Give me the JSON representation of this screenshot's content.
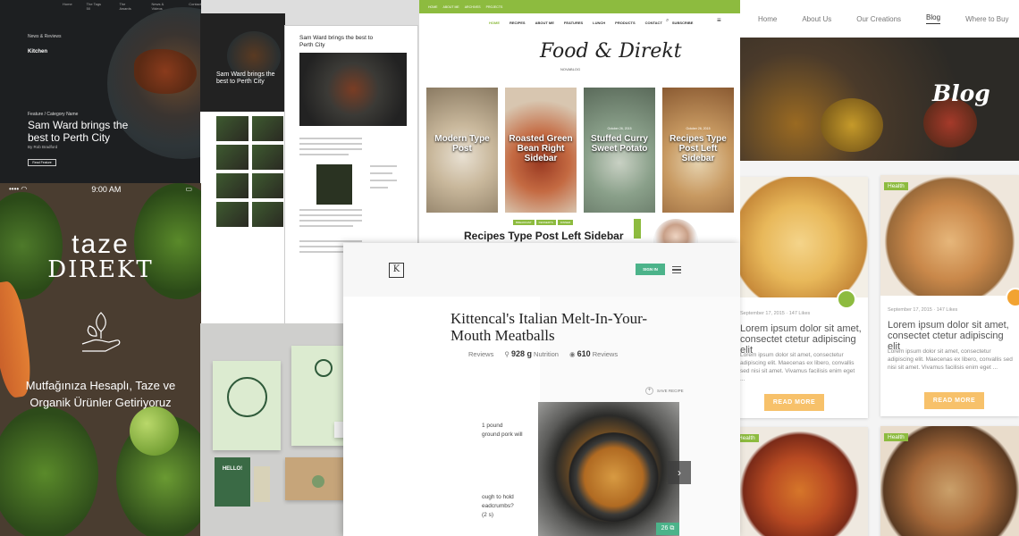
{
  "p1": {
    "nav": [
      "Home",
      "The Tags 50",
      "The Awards",
      "News & Videos",
      "Contact"
    ],
    "eyebrow": "News & Reviews",
    "sponsor": "Kitchen",
    "category": "Feature / Category Name",
    "title": "Sam Ward brings the best to Perth City",
    "byline": "By Rob Bradford",
    "button": "Read Feature"
  },
  "p2": {
    "title": "Sam Ward brings the best to Perth City"
  },
  "p3": {
    "title": "Sam Ward brings the best to Perth City"
  },
  "p4": {
    "topbar": [
      "HOME",
      "ABOUT ME",
      "ARCHIVES",
      "PROJECTS"
    ],
    "menu": [
      "HOME",
      "RECIPES",
      "ABOUT ME",
      "FEATURES",
      "LUNCH",
      "PRODUCTS",
      "CONTACT",
      "SUBSCRIBE"
    ],
    "brand": "Food & Direkt",
    "brand_sub": "NOVABLOG",
    "cards": [
      {
        "label": "Modern Type Post",
        "date": ""
      },
      {
        "label": "Roasted Green Bean Right Sidebar",
        "date": ""
      },
      {
        "label": "Stuffed Curry Sweet Potato",
        "date": "October 26, 2015"
      },
      {
        "label": "Recipes Type Post Left Sidebar",
        "date": "October 26, 2015"
      }
    ],
    "tags": [
      "BREAKFAST",
      "DESSERTS",
      "DINNER"
    ],
    "heading": "Recipes Type Post Left Sidebar"
  },
  "p5": {
    "nav": [
      "Home",
      "About Us",
      "Our Creations",
      "Blog",
      "Where to Buy"
    ],
    "hero_title": "Blog",
    "cards": [
      {
        "tag": "",
        "meta": "September 17, 2015  ·  147 Likes",
        "title": "Lorem ipsum dolor sit amet, consectet ctetur adipiscing elit",
        "excerpt": "Lorem ipsum dolor sit amet, consectetur adipiscing elit. Maecenas ex libero, convallis sed nisi sit amet. Vivamus facilisis enim eget ...",
        "button": "READ MORE"
      },
      {
        "tag": "Health",
        "meta": "September 17, 2015  ·  147 Likes",
        "title": "Lorem ipsum dolor sit amet, consectet ctetur adipiscing elit",
        "excerpt": "Lorem ipsum dolor sit amet, consectetur adipiscing elit. Maecenas ex libero, convallis sed nisi sit amet. Vivamus facilisis enim eget ...",
        "button": "READ MORE"
      },
      {
        "tag": "Health"
      },
      {
        "tag": "Health"
      }
    ]
  },
  "p6": {
    "status_time": "9:00 AM",
    "brand_line1": "taze",
    "brand_line2": "DIREKT",
    "slogan": "Mutfağınıza Hesaplı, Taze ve Organik Ürünler Getiriyoruz"
  },
  "p7": {
    "hello": "HELLO!"
  },
  "p8": {
    "signin": "SIGN IN",
    "title": "Kittencal's Italian Melt-In-Your-Mouth Meatballs",
    "stats": [
      {
        "value": "",
        "label": "Reviews"
      },
      {
        "value": "928 g",
        "label": "Nutrition"
      },
      {
        "value": "610",
        "label": "Reviews"
      }
    ],
    "save": "SAVE RECIPE",
    "ingredients": [
      "1 pound",
      "ground pork will",
      "",
      "",
      "",
      "",
      "",
      "",
      "ough to hold",
      "eadcrumbs?",
      "(2 s)"
    ],
    "photo_count": "26"
  }
}
